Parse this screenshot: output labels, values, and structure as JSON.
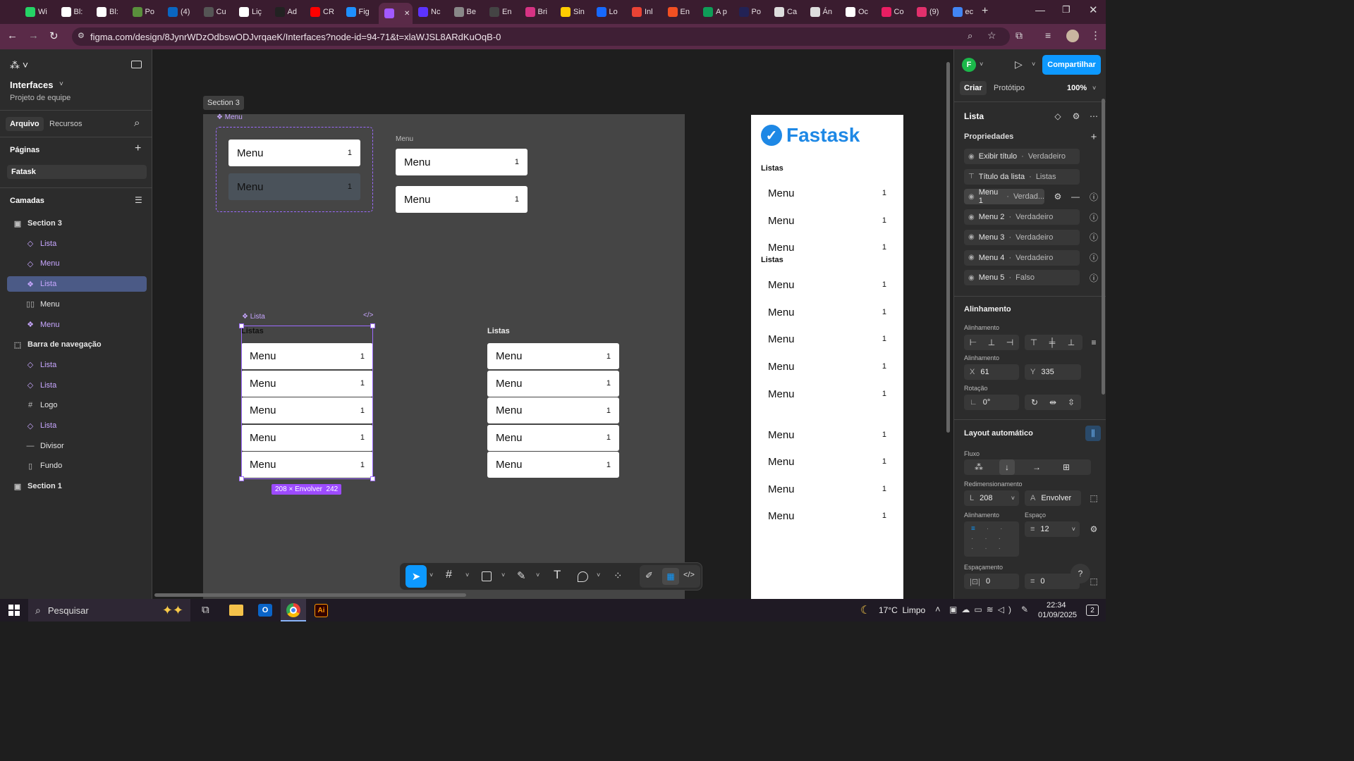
{
  "browser": {
    "tabs": [
      {
        "label": "Wi",
        "color": "#25d366"
      },
      {
        "label": "Bl:",
        "color": "#ffffff"
      },
      {
        "label": "Bl:",
        "color": "#ffffff"
      },
      {
        "label": "Po",
        "color": "#5a8f3c"
      },
      {
        "label": "(4)",
        "color": "#0a66c2"
      },
      {
        "label": "Cu",
        "color": "#555555"
      },
      {
        "label": "Liç",
        "color": "#ffffff"
      },
      {
        "label": "Ad",
        "color": "#222222"
      },
      {
        "label": "CR",
        "color": "#ff0000"
      },
      {
        "label": "Fig",
        "color": "#1e90ff"
      },
      {
        "label": "",
        "color": "#a259ff"
      },
      {
        "label": "Nc",
        "color": "#5c33ff"
      },
      {
        "label": "Be",
        "color": "#888888"
      },
      {
        "label": "En",
        "color": "#444444"
      },
      {
        "label": "Bri",
        "color": "#d63384"
      },
      {
        "label": "Sin",
        "color": "#ffcc00"
      },
      {
        "label": "Lo",
        "color": "#1769ff"
      },
      {
        "label": "Inl",
        "color": "#ea4335"
      },
      {
        "label": "En",
        "color": "#f25022"
      },
      {
        "label": "A p",
        "color": "#0f9d58"
      },
      {
        "label": "Po",
        "color": "#222255"
      },
      {
        "label": "Ca",
        "color": "#dddddd"
      },
      {
        "label": "Án",
        "color": "#dddddd"
      },
      {
        "label": "Oc",
        "color": "#ffffff"
      },
      {
        "label": "Co",
        "color": "#e91e63"
      },
      {
        "label": "(9)",
        "color": "#e1306c"
      },
      {
        "label": "ec",
        "color": "#4285f4"
      }
    ],
    "url": "figma.com/design/8JynrWDzOdbswODJvrqaeK/Interfaces?node-id=94-71&t=xlaWJSL8ARdKuOqB-0"
  },
  "left": {
    "file_title": "Interfaces",
    "file_sub": "Projeto de equipe",
    "tab_file": "Arquivo",
    "tab_assets": "Recursos",
    "pages_title": "Páginas",
    "page": "Fatask",
    "layers_title": "Camadas",
    "layers": [
      {
        "label": "Section 3",
        "icon": "▣",
        "indent": 0
      },
      {
        "label": "Lista",
        "icon": "◇",
        "indent": 1
      },
      {
        "label": "Menu",
        "icon": "◇",
        "indent": 1
      },
      {
        "label": "Lista",
        "icon": "❖",
        "indent": 1
      },
      {
        "label": "Menu",
        "icon": "▯▯",
        "indent": 1
      },
      {
        "label": "Menu",
        "icon": "❖",
        "indent": 1
      },
      {
        "label": "Barra de navegação",
        "icon": "⬚",
        "indent": 0
      },
      {
        "label": "Lista",
        "icon": "◇",
        "indent": 1
      },
      {
        "label": "Lista",
        "icon": "◇",
        "indent": 1
      },
      {
        "label": "Logo",
        "icon": "#",
        "indent": 1
      },
      {
        "label": "Lista",
        "icon": "◇",
        "indent": 1
      },
      {
        "label": "Divisor",
        "icon": "—",
        "indent": 1
      },
      {
        "label": "Fundo",
        "icon": "▯",
        "indent": 1
      },
      {
        "label": "Section 1",
        "icon": "▣",
        "indent": 0
      }
    ]
  },
  "canvas": {
    "section_label": "Section 3",
    "menu_comp_label": "Menu",
    "menu_label_2": "Menu",
    "lista_label": "Lista",
    "listas_title": "Listas",
    "item_text": "Menu",
    "item_count": "1",
    "size_badge": "208 × Envolver  242",
    "fastask_logo": "Fastask",
    "fk_listas_1": "Listas",
    "fk_listas_2": "Listas"
  },
  "right": {
    "avatar": "F",
    "share": "Compartilhar",
    "tab_create": "Criar",
    "tab_proto": "Protótipo",
    "zoom": "100%",
    "layer_name": "Lista",
    "props_title": "Propriedades",
    "props": [
      {
        "label": "Exibir título",
        "value": "Verdadeiro"
      },
      {
        "label": "Título da lista",
        "value": "Listas"
      },
      {
        "label": "Menu 1",
        "value": "Verdad..."
      },
      {
        "label": "Menu 2",
        "value": "Verdadeiro"
      },
      {
        "label": "Menu 3",
        "value": "Verdadeiro"
      },
      {
        "label": "Menu 4",
        "value": "Verdadeiro"
      },
      {
        "label": "Menu 5",
        "value": "Falso"
      }
    ],
    "align_title": "Alinhamento",
    "align_sub": "Alinhamento",
    "pos_sub": "Alinhamento",
    "x": "61",
    "y": "335",
    "rot_sub": "Rotação",
    "rotation": "0°",
    "autolayout_title": "Layout automático",
    "flow_sub": "Fluxo",
    "resize_sub": "Redimensionamento",
    "width": "208",
    "height": "Envolver",
    "al_sub": "Alinhamento",
    "gap_sub": "Espaço",
    "gap": "12",
    "pad_sub": "Espaçamento",
    "pad_h": "0",
    "pad_v": "0"
  },
  "taskbar": {
    "search": "Pesquisar",
    "weather": "17°C  Limpo",
    "time": "22:34",
    "date": "01/09/2025",
    "notif": "2"
  }
}
